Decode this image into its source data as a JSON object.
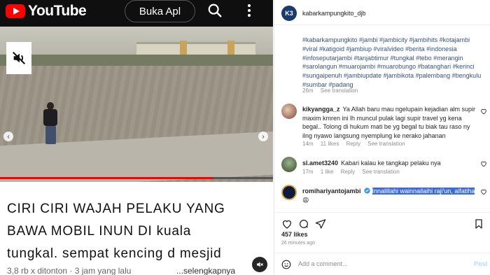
{
  "youtube": {
    "logo_text": "YouTube",
    "open_app_label": "Buka Apl",
    "progress_fraction": 0.78,
    "caption_lines": [
      "CIRI CIRI WAJAH PELAKU YANG",
      "BAWA MOBIL INUN DI kuala",
      "tungkal. sempat kencing d mesjid"
    ],
    "meta": "3,8 rb x ditonton · 3 jam yang lalu",
    "more_label": "...selengkapnya"
  },
  "instagram": {
    "avatar_text": "K3",
    "username": "kabarkampungkito_djb",
    "hashtags": "#kabarkampungkito #jambi #jambicity #jambihits #kotajambi #viral #katigoid #jambiup #viralvideo #berita #indonesia #infoseputarjambi #tanjabtimur #tungkal #tebo #merangin #sarolangun #muarojambi #muarobungo #batanghari #kerinci #sungaipenuh #jambiupdate #jambikota #palembang #bengkulu #sumbar #padang",
    "caption_time": "26m",
    "see_translation": "See translation",
    "comments": [
      {
        "user": "kikyangga_z",
        "text": "Ya Allah baru mau ngelupain kejadian alm supir maxim kmren ini lh muncul pulak lagi supir travel yg kena begal.. Tolong di hukum mati be yg begal tu biak tau raso ny ilng nyawo langsung nyemplung ke nerako jahanan",
        "time": "14m",
        "likes": "11 likes",
        "reply": "Reply",
        "translate": "See translation"
      },
      {
        "user": "sl.amet3240",
        "text": "Kabari kalau ke tangkap pelaku nya",
        "time": "17m",
        "likes": "1 like",
        "reply": "Reply",
        "translate": "See translation"
      },
      {
        "user": "romihariyantojambi",
        "text": "Innalillahi wainnailaihi raji'un, alfatiha",
        "emoji": "😩"
      }
    ],
    "likes_count": "457 likes",
    "post_time": "26 minutes ago",
    "add_comment_placeholder": "Add a comment...",
    "post_label": "Post"
  }
}
